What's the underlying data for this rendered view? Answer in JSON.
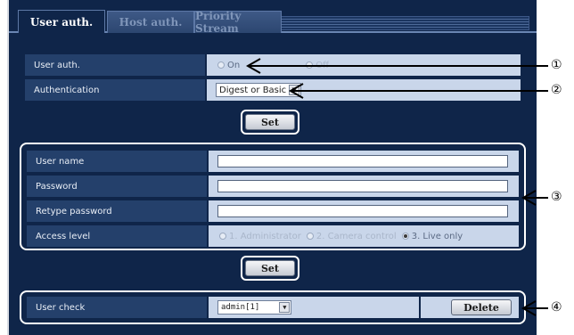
{
  "tabs": [
    {
      "label": "User auth.",
      "active": true
    },
    {
      "label": "Host auth.",
      "active": false
    },
    {
      "label": "Priority Stream",
      "active": false
    }
  ],
  "auth_section": {
    "user_auth": {
      "label": "User auth.",
      "options": [
        "On",
        "Off"
      ],
      "selected": "On"
    },
    "authentication": {
      "label": "Authentication",
      "value": "Digest or Basic"
    }
  },
  "set_label": "Set",
  "user_section": {
    "username_label": "User name",
    "username_value": "",
    "password_label": "Password",
    "password_value": "",
    "retype_label": "Retype password",
    "retype_value": "",
    "access_level": {
      "label": "Access level",
      "options": [
        "1. Administrator",
        "2. Camera control",
        "3. Live only"
      ],
      "selected": "3. Live only"
    }
  },
  "user_check": {
    "label": "User check",
    "value": "admin[1]",
    "delete_label": "Delete"
  },
  "callouts": [
    "①",
    "②",
    "③",
    "④"
  ],
  "colors": {
    "background": "#0f2549",
    "label_cell": "#24406b",
    "value_cell": "#c9d6ea",
    "outline": "#ffffff"
  }
}
